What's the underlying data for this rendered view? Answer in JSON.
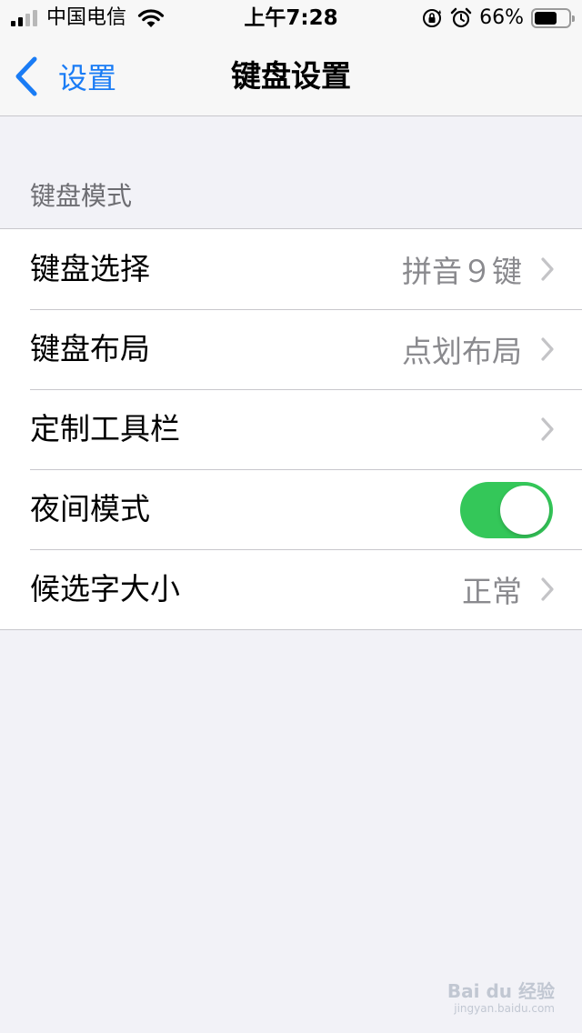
{
  "status_bar": {
    "carrier": "中国电信",
    "time": "上午7:28",
    "battery_percent": "66%",
    "battery_level": 0.66,
    "signal_bars_filled": 2,
    "signal_bars_total": 4,
    "icons": [
      "wifi-icon",
      "rotation-lock-icon",
      "alarm-icon",
      "battery-icon"
    ]
  },
  "nav": {
    "back_label": "设置",
    "title": "键盘设置",
    "back_icon": "chevron-left-icon"
  },
  "section": {
    "header": "键盘模式",
    "rows": [
      {
        "label": "键盘选择",
        "value": "拼音９键",
        "type": "disclosure"
      },
      {
        "label": "键盘布局",
        "value": "点划布局",
        "type": "disclosure"
      },
      {
        "label": "定制工具栏",
        "value": "",
        "type": "disclosure"
      },
      {
        "label": "夜间模式",
        "type": "toggle",
        "on": true
      },
      {
        "label": "候选字大小",
        "value": "正常",
        "type": "disclosure"
      }
    ]
  },
  "watermark": {
    "line1": "Bai du 经验",
    "line2": "jingyan.baidu.com"
  },
  "colors": {
    "accent": "#1a7cf5",
    "toggle_on": "#34c759",
    "background": "#f2f2f7",
    "secondary_text": "#8a8a8e"
  }
}
